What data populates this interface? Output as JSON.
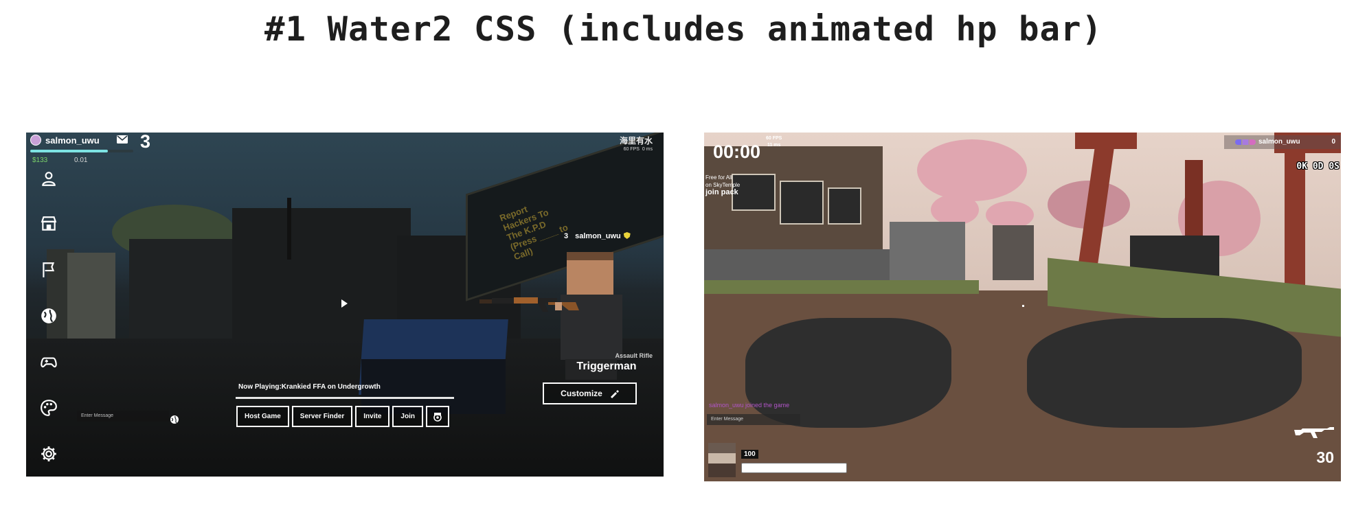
{
  "page": {
    "title": "#1 Water2 CSS (includes animated hp bar)"
  },
  "menu_screen": {
    "user": {
      "name": "salmon_uwu",
      "level": "3",
      "money": "$133",
      "kr": "0.01",
      "xp_fraction": 0.75
    },
    "region": "海里有水",
    "fps": "60 FPS",
    "ping": "0 ms",
    "sidebar": [
      "profile-icon",
      "store-icon",
      "flag-icon",
      "globe-icon",
      "gamepad-icon",
      "palette-icon",
      "settings-icon"
    ],
    "player_tag": {
      "level": "3",
      "name": "salmon_uwu"
    },
    "billboard_text": "Report Hackers To The K.P.D (Press ____ to Call)",
    "weapon": {
      "class": "Assault Rifle",
      "name": "Triggerman"
    },
    "customize_label": "Customize",
    "now_playing": "Now Playing:Krankied FFA on Undergrowth",
    "buttons": {
      "host": "Host Game",
      "server": "Server Finder",
      "invite": "Invite",
      "join": "Join"
    },
    "chat_placeholder": "Enter Message",
    "colors": {
      "xp": "#7de3e3",
      "money": "#7bd36a"
    }
  },
  "game_screen": {
    "timer": "00:00",
    "fps": "60 FPS",
    "ping": "11 ms",
    "mode": {
      "line1": "Free for All",
      "line2": "on SkyTemple",
      "line3": "join pack"
    },
    "leaderboard": {
      "name": "salmon_uwu",
      "score": "0"
    },
    "kda": "0K 0D 0S",
    "feed": "salmon_uwu joined the game",
    "chat_placeholder": "Enter Message",
    "hp": "100",
    "hp_fraction": 1.0,
    "ammo": "30",
    "colors": {
      "feed": "#b155c8"
    }
  }
}
